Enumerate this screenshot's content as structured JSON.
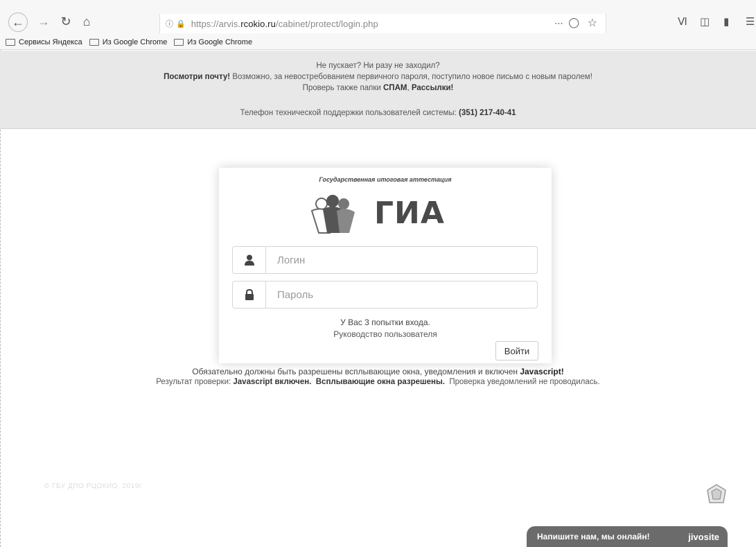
{
  "browser": {
    "url_prefix": "https://arvis.",
    "url_domain": "rcokio.ru",
    "url_path": "/cabinet/protect/login.php",
    "bookmarks": [
      "Сервисы Яндекса",
      "Из Google Chrome",
      "Из Google Chrome"
    ]
  },
  "banner": {
    "line1": "Не пускает? Ни разу не заходил?",
    "line2_bold": "Посмотри почту!",
    "line2_rest": " Возможно, за невостребованием первичного пароля, поступило новое письмо с новым паролем!",
    "line3_prefix": "Проверь также папки ",
    "line3_spam": "СПАМ",
    "line3_sep": ", ",
    "line3_mail": "Рассылки!",
    "phone_label": "Телефон технической поддержки пользователей системы: ",
    "phone_number": "(351) 217-40-41"
  },
  "card": {
    "subtitle": "Государственная итоговая аттестация",
    "logo_text": "ГИА",
    "login_placeholder": "Логин",
    "password_placeholder": "Пароль",
    "attempts": "У Вас 3 попытки входа.",
    "manual_link": "Руководство пользователя",
    "submit": "Войти"
  },
  "requirements": {
    "line1_text": "Обязательно должны быть разрешены всплывающие окна, уведомления и включен ",
    "line1_bold": "Javascript!",
    "check_label": "Результат проверки: ",
    "check_js": "Javascript включен.",
    "check_popups": "Всплывающие окна разрешены.",
    "check_notify": "Проверка уведомлений не проводилась."
  },
  "footer": {
    "copyright": "© ГБУ ДПО РЦОКИО, 2019г"
  },
  "chat": {
    "text": "Напишите нам, мы онлайн!",
    "brand": "jivosite"
  },
  "colors": {
    "banner_bg": "#e8e8e8",
    "chat_bg": "#6b6b6b"
  }
}
